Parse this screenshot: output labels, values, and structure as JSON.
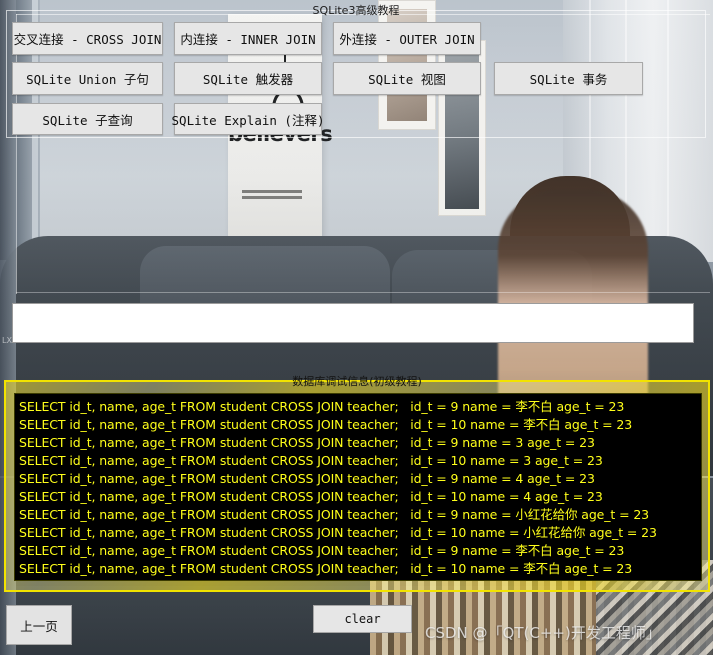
{
  "window": {
    "title": "SQLite3高级教程"
  },
  "top_group": {
    "title": "SQLite3高级教程",
    "buttons": [
      {
        "label": "交叉连接 - CROSS JOIN",
        "col": "c1",
        "row": "r1",
        "name": "btn-cross-join"
      },
      {
        "label": "内连接 - INNER JOIN",
        "col": "c2",
        "row": "r1",
        "name": "btn-inner-join"
      },
      {
        "label": "外连接 - OUTER JOIN",
        "col": "c3",
        "row": "r1",
        "name": "btn-outer-join"
      },
      {
        "label": "SQLite Union 子句",
        "col": "c1",
        "row": "r2",
        "name": "btn-union"
      },
      {
        "label": "SQLite 触发器",
        "col": "c2",
        "row": "r2",
        "name": "btn-trigger"
      },
      {
        "label": "SQLite 视图",
        "col": "c3",
        "row": "r2",
        "name": "btn-view"
      },
      {
        "label": "SQLite 事务",
        "col": "c4",
        "row": "r2",
        "name": "btn-transaction"
      },
      {
        "label": "SQLite 子查询",
        "col": "c1",
        "row": "r3",
        "name": "btn-subquery"
      },
      {
        "label": "SQLite Explain (注释)",
        "col": "c2",
        "row": "r3",
        "name": "btn-explain"
      }
    ]
  },
  "input": {
    "value": "",
    "placeholder": ""
  },
  "log_group": {
    "title": "数据库调试信息(初级教程)",
    "border_color": "#f2e300",
    "text_color": "#ffff1a",
    "background_color": "#000000",
    "lines": [
      "SELECT id_t, name, age_t FROM student CROSS JOIN teacher;   id_t = 9 name = 李不白 age_t = 23",
      "SELECT id_t, name, age_t FROM student CROSS JOIN teacher;   id_t = 10 name = 李不白 age_t = 23",
      "SELECT id_t, name, age_t FROM student CROSS JOIN teacher;   id_t = 9 name = 3 age_t = 23",
      "SELECT id_t, name, age_t FROM student CROSS JOIN teacher;   id_t = 10 name = 3 age_t = 23",
      "SELECT id_t, name, age_t FROM student CROSS JOIN teacher;   id_t = 9 name = 4 age_t = 23",
      "SELECT id_t, name, age_t FROM student CROSS JOIN teacher;   id_t = 10 name = 4 age_t = 23",
      "SELECT id_t, name, age_t FROM student CROSS JOIN teacher;   id_t = 9 name = 小红花给你 age_t = 23",
      "SELECT id_t, name, age_t FROM student CROSS JOIN teacher;   id_t = 10 name = 小红花给你 age_t = 23",
      "SELECT id_t, name, age_t FROM student CROSS JOIN teacher;   id_t = 9 name = 李不白 age_t = 23",
      "SELECT id_t, name, age_t FROM student CROSS JOIN teacher;   id_t = 10 name = 李不白 age_t = 23"
    ]
  },
  "footer": {
    "prev_label": "上一页",
    "clear_label": "clear",
    "watermark": "CSDN @「QT(C++)开发工程师」",
    "corner_text": "LX"
  },
  "background": {
    "poster_text": "believers"
  }
}
